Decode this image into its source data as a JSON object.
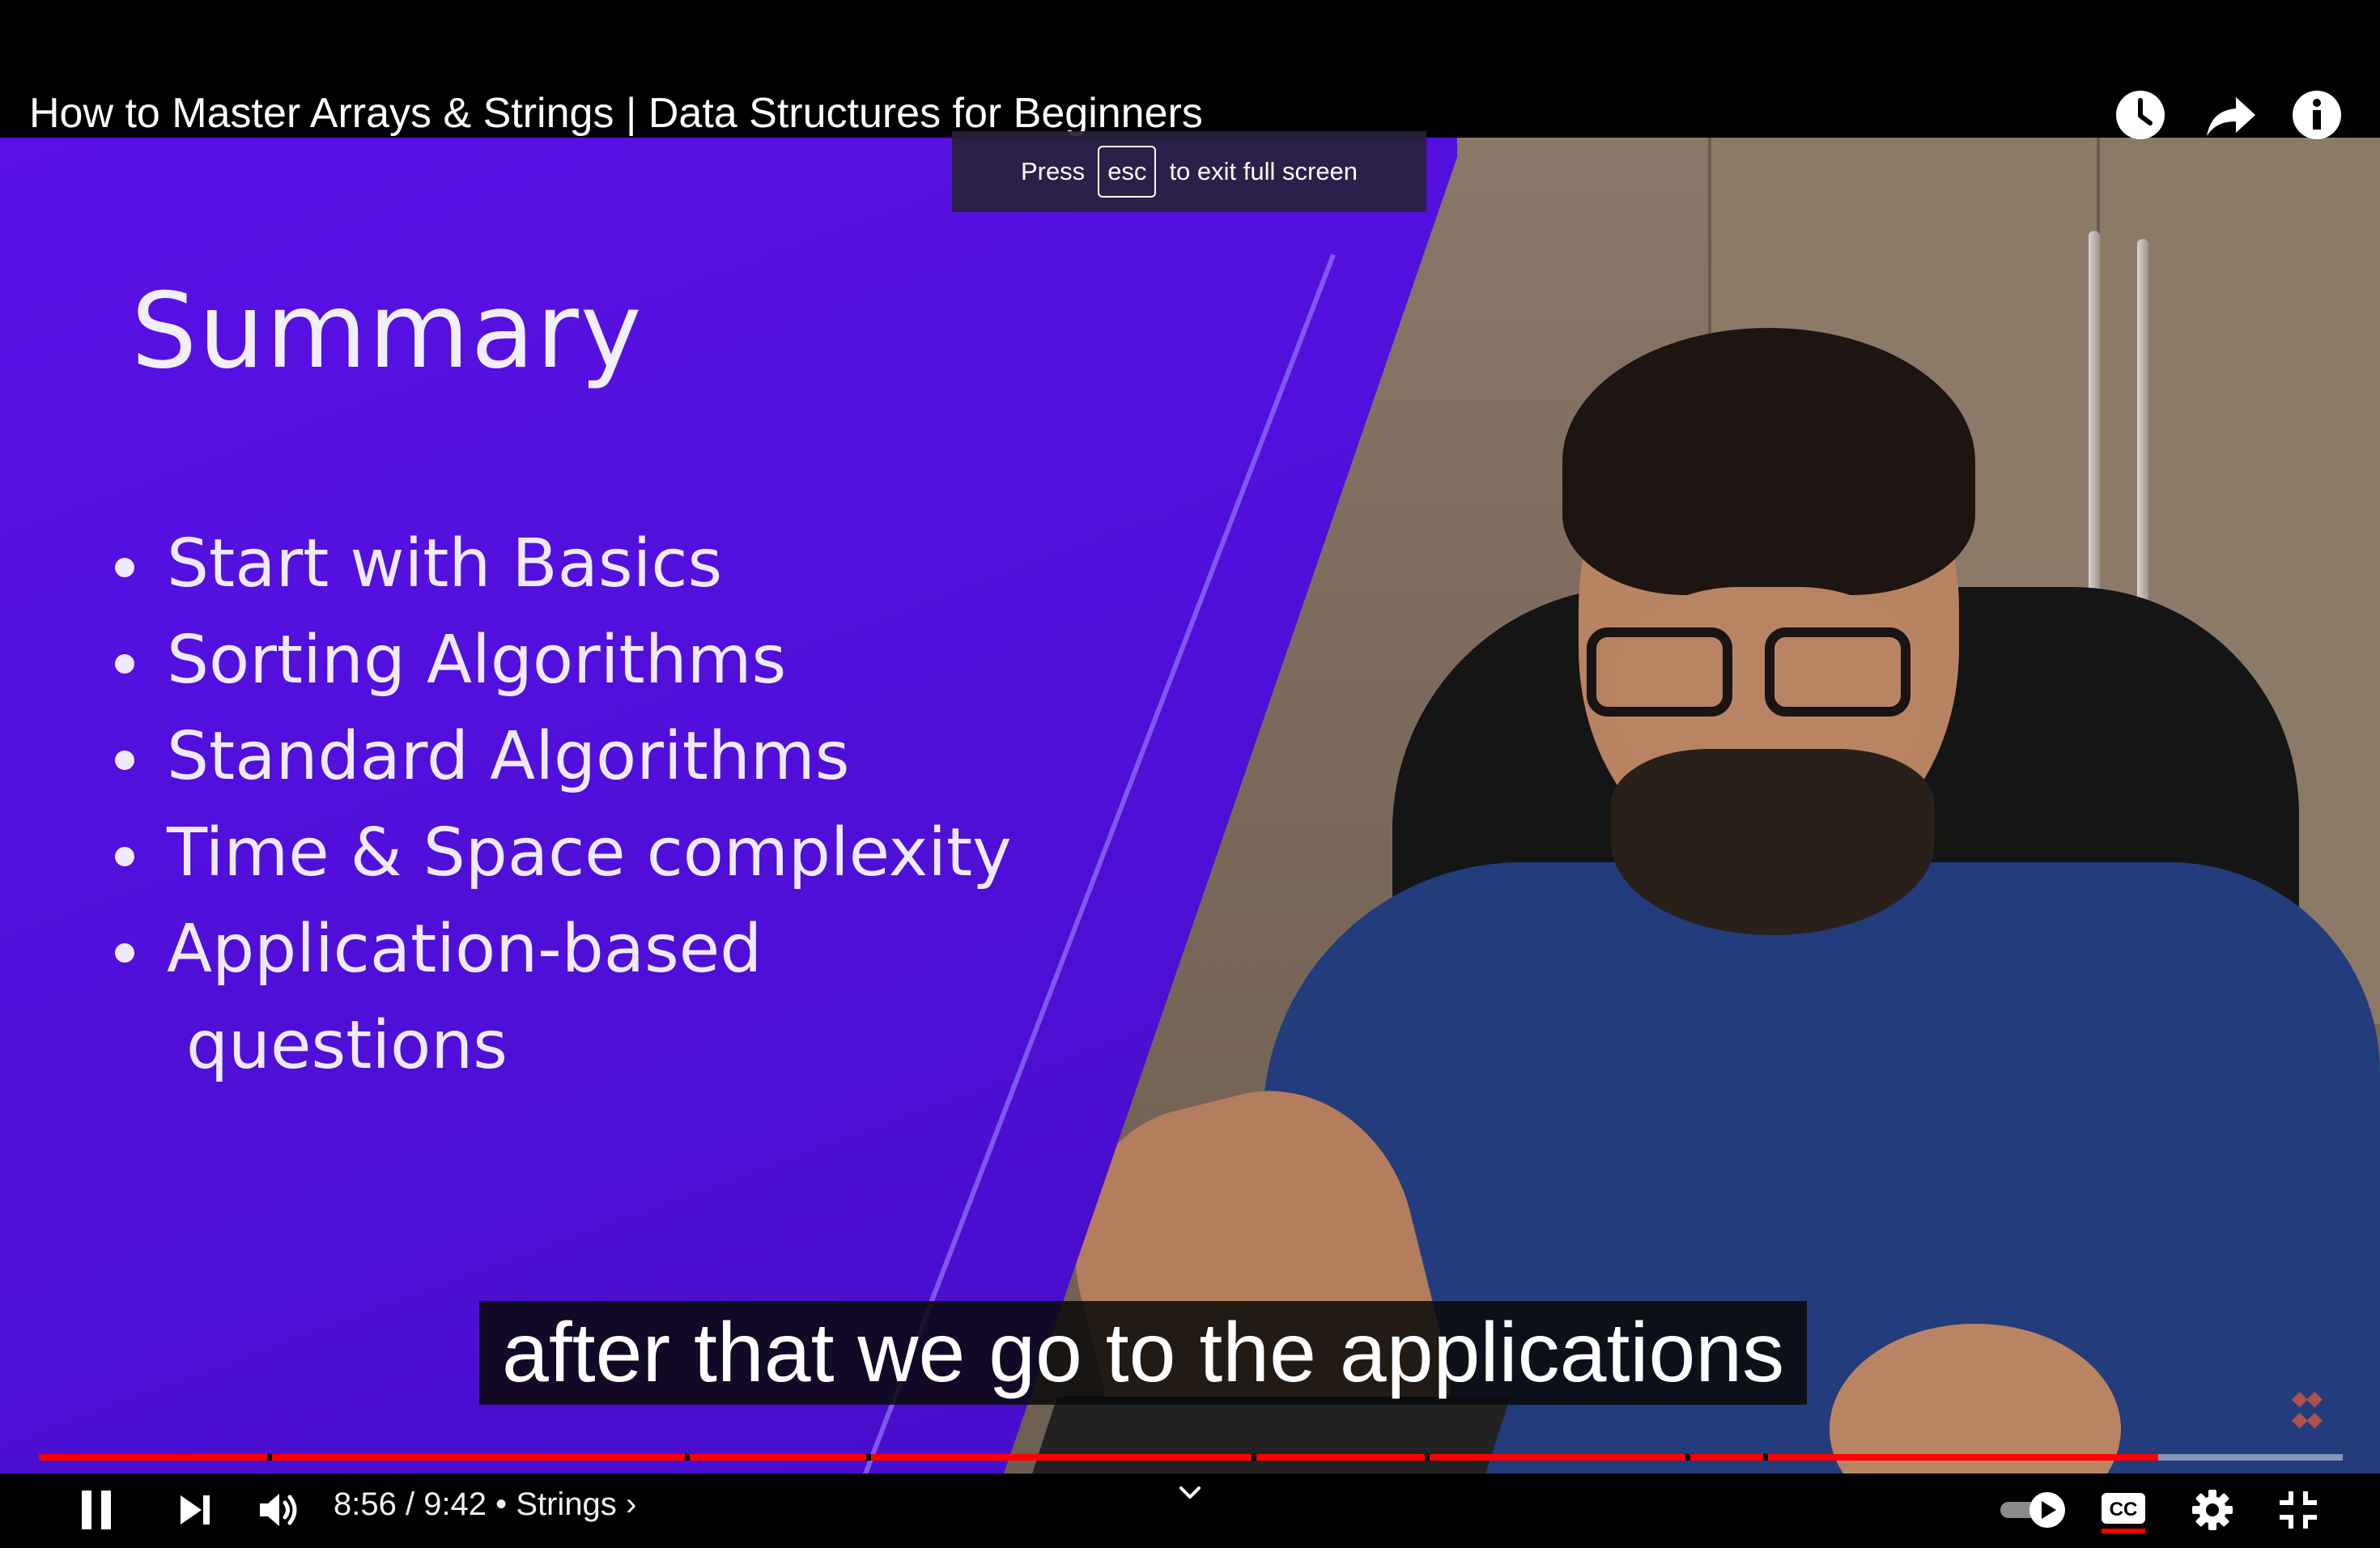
{
  "video": {
    "title": "How to Master Arrays & Strings | Data Structures for Beginners",
    "slide": {
      "title": "Summary",
      "bullets": [
        "Start with Basics",
        "Sorting Algorithms",
        "Standard Algorithms",
        "Time & Space complexity",
        "Application-based"
      ],
      "bullet_continuation": "questions"
    },
    "watermark_logo": "Coding Minutes",
    "caption": "after that we go to the applications"
  },
  "fullscreen_toast": {
    "press": "Press",
    "key": "esc",
    "suffix": "to exit full screen"
  },
  "top_actions": [
    "watch-later-icon",
    "share-icon",
    "info-icon"
  ],
  "player": {
    "current_time": "8:56",
    "duration": "9:42",
    "time_display": "8:56 / 9:42",
    "separator": "•",
    "chapter": "Strings",
    "chapter_chevron": "›",
    "progress_fraction": 0.92,
    "autoplay": true,
    "captions_enabled": true,
    "accent_color": "#ff0000"
  }
}
